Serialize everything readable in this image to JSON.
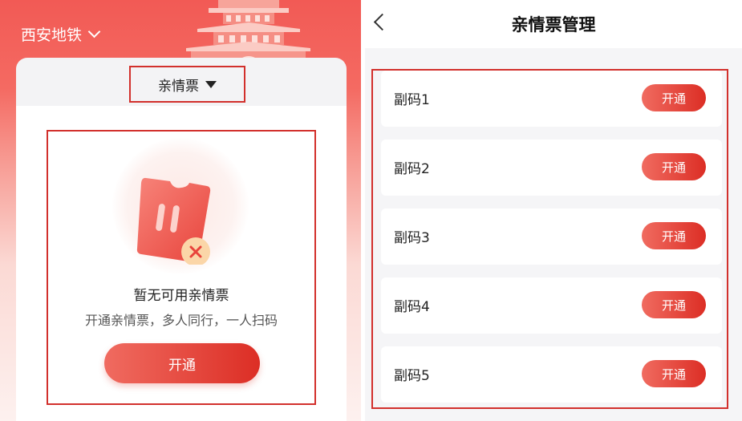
{
  "left_screen": {
    "city_selector": "西安地铁",
    "ticket_type_tab": "亲情票",
    "empty_state": {
      "title": "暂无可用亲情票",
      "subtitle": "开通亲情票，多人同行，一人扫码",
      "open_button": "开通"
    }
  },
  "right_screen": {
    "title": "亲情票管理",
    "sub_codes": [
      {
        "label": "副码1",
        "button": "开通"
      },
      {
        "label": "副码2",
        "button": "开通"
      },
      {
        "label": "副码3",
        "button": "开通"
      },
      {
        "label": "副码4",
        "button": "开通"
      },
      {
        "label": "副码5",
        "button": "开通"
      }
    ]
  },
  "colors": {
    "accent": "#dc2e25",
    "highlight_border": "#d2302c"
  }
}
